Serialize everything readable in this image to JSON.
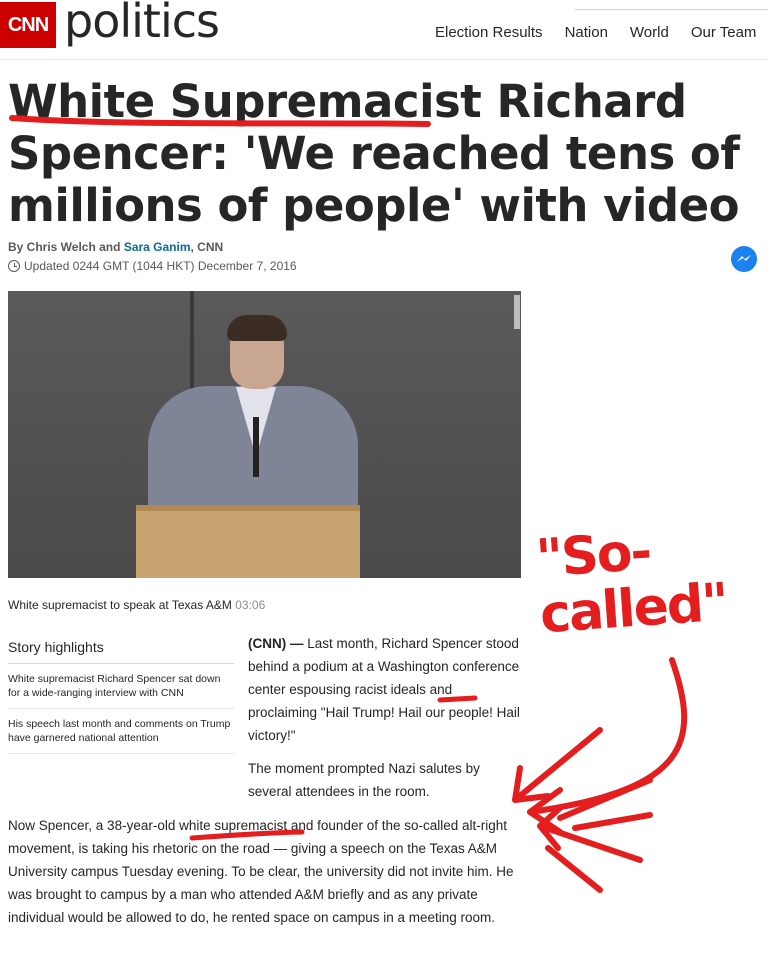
{
  "header": {
    "logo_text": "CNN",
    "section": "politics",
    "nav": [
      "Election Results",
      "Nation",
      "World",
      "Our Team"
    ]
  },
  "article": {
    "headline": "White Supremacist Richard Spencer: 'We reached tens of millions of people' with video",
    "byline_prefix": "By Chris Welch and ",
    "byline_link": "Sara Ganim",
    "byline_suffix": ", CNN",
    "updated": "Updated 0244 GMT (1044 HKT) December 7, 2016",
    "video_caption": "White supremacist to speak at Texas A&M",
    "video_duration": "03:06"
  },
  "highlights": {
    "title": "Story highlights",
    "items": [
      "White supremacist Richard Spencer sat down for a wide-ranging interview with CNN",
      "His speech last month and comments on Trump have garnered national attention"
    ]
  },
  "body": {
    "lede": "(CNN) —",
    "para1": "Last month, Richard Spencer stood behind a podium at a Washington conference center espousing racist ideals and proclaiming \"Hail Trump! Hail our people! Hail victory!\"",
    "para2": "The moment prompted Nazi salutes by several attendees in the room.",
    "para3": "Now Spencer, a 38-year-old white supremacist and founder of the so-called alt-right movement, is taking his rhetoric on the road — giving a speech on the Texas A&M University campus Tuesday evening. To be clear, the university did not invite him. He was brought to campus by a man who attended A&M briefly and as any private individual would be allowed to do, he rented space on campus in a meeting room."
  },
  "annotation": {
    "text_line1": "\"So-",
    "text_line2": "called\"",
    "color": "#e41e1e"
  },
  "icons": {
    "share": "messenger-icon",
    "time": "clock-icon"
  }
}
